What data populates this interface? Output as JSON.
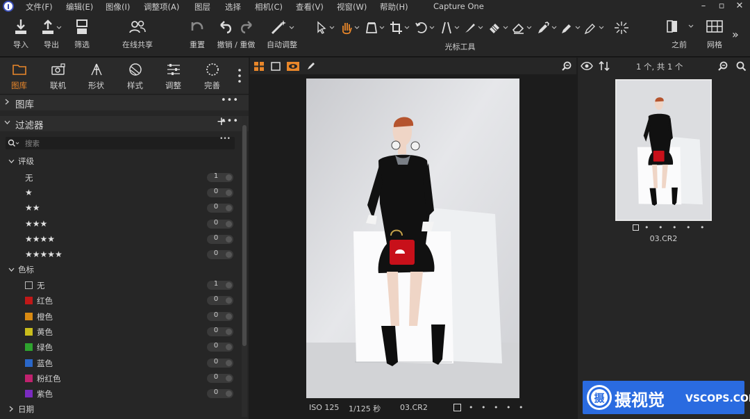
{
  "app": {
    "title": "Capture One"
  },
  "menu": [
    "文件(F)",
    "编辑(E)",
    "图像(I)",
    "调整项(A)",
    "图层",
    "选择",
    "相机(C)",
    "查看(V)",
    "视窗(W)",
    "帮助(H)"
  ],
  "toolbar": {
    "import": "导入",
    "export": "导出",
    "filter": "筛选",
    "share": "在线共享",
    "reset": "重置",
    "undo_redo": "撤销 / 重做",
    "auto_adjust": "自动调整",
    "cursor_tools": "光标工具",
    "before": "之前",
    "grid": "网格"
  },
  "tool_tabs": [
    "图库",
    "联机",
    "形状",
    "样式",
    "调整",
    "完善"
  ],
  "library_section": {
    "title": "图库"
  },
  "filters_section": {
    "title": "过滤器",
    "search_placeholder": "搜索",
    "rating_title": "评级",
    "ratings": [
      {
        "label": "无",
        "count": "1"
      },
      {
        "label": "★",
        "count": "0"
      },
      {
        "label": "★★",
        "count": "0"
      },
      {
        "label": "★★★",
        "count": "0"
      },
      {
        "label": "★★★★",
        "count": "0"
      },
      {
        "label": "★★★★★",
        "count": "0"
      }
    ],
    "color_title": "色标",
    "colors": [
      {
        "label": "无",
        "count": "1",
        "color": "transparent"
      },
      {
        "label": "红色",
        "count": "0",
        "color": "#c01818"
      },
      {
        "label": "橙色",
        "count": "0",
        "color": "#d98a12"
      },
      {
        "label": "黄色",
        "count": "0",
        "color": "#c9bd1c"
      },
      {
        "label": "绿色",
        "count": "0",
        "color": "#2ea32e"
      },
      {
        "label": "蓝色",
        "count": "0",
        "color": "#2a67c8"
      },
      {
        "label": "粉红色",
        "count": "0",
        "color": "#c0226e"
      },
      {
        "label": "紫色",
        "count": "0",
        "color": "#7a2bbf"
      }
    ],
    "date_title": "日期"
  },
  "viewer": {
    "iso": "ISO 125",
    "shutter": "1/125 秒",
    "filename": "03.CR2",
    "rating_dots": "• • • • •"
  },
  "browser": {
    "count": "1 个, 共 1 个",
    "thumb_name": "03.CR2",
    "thumb_rating": "• • • • •"
  },
  "watermark": {
    "name": "摄视觉",
    "domain": "VSCOPS.COM",
    "seal": "摄"
  },
  "colors": {
    "accent": "#e9872a",
    "panel": "#262626",
    "dark": "#1c1c1c"
  }
}
